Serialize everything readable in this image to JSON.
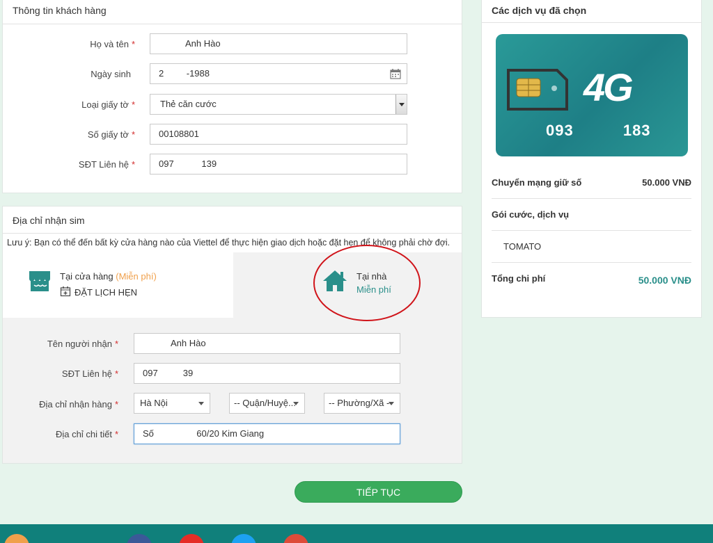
{
  "customer": {
    "title": "Thông tin khách hàng",
    "fields": [
      {
        "label": "Họ và tên",
        "required": "*",
        "value": "Anh Hào"
      },
      {
        "label": "Ngày sinh",
        "required": "",
        "value": "2         -1988"
      },
      {
        "label": "Loại giấy tờ",
        "required": "*",
        "value": "Thẻ căn cước"
      },
      {
        "label": "Số giấy tờ",
        "required": "*",
        "value": "00108801"
      },
      {
        "label": "SĐT Liên hệ",
        "required": "*",
        "value": "097           139"
      }
    ]
  },
  "address": {
    "title": "Địa chỉ nhận sim",
    "note": "Lưu ý: Bạn có thể đến bất kỳ cửa hàng nào của Viettel để thực hiện giao dịch hoặc đặt hẹn để không phải chờ đợi.",
    "store_option": {
      "label": "Tại cửa hàng",
      "price": "(Miễn phí)",
      "schedule": "ĐẶT LỊCH HẸN"
    },
    "home_option": {
      "label": "Tại nhà",
      "price": "Miễn phí"
    },
    "fields": {
      "receiver": {
        "label": "Tên người nhận",
        "required": "*",
        "value": "Anh Hào"
      },
      "phone": {
        "label": "SĐT Liên hệ",
        "required": "*",
        "value": "097          39"
      },
      "place": {
        "label": "Địa chỉ nhận hàng",
        "required": "*",
        "province": "Hà Nội",
        "district": "-- Quận/Huyệ...",
        "ward": "-- Phường/Xã --"
      },
      "detail": {
        "label": "Địa chỉ chi tiết",
        "required": "*",
        "value": "Số                 60/20 Kim Giang"
      }
    }
  },
  "continue_button": "TIẾP TỤC",
  "services": {
    "title": "Các dịch vụ đã chọn",
    "sim": {
      "badge": "4G",
      "number": "093          183"
    },
    "rows": [
      {
        "label": "Chuyển mạng giữ số",
        "value": "50.000 VNĐ"
      },
      {
        "label": "Gói cước, dịch vụ",
        "value": ""
      },
      {
        "label": "TOMATO",
        "value": ""
      }
    ],
    "total_label": "Tổng chi phí",
    "total_value": "50.000 VNĐ"
  },
  "colors": {
    "accent": "#2e9a6a",
    "teal": "#2a8f8a",
    "orange": "#f0a04b",
    "required": "#d32f2f",
    "annotation_circle": "#d0141a"
  }
}
